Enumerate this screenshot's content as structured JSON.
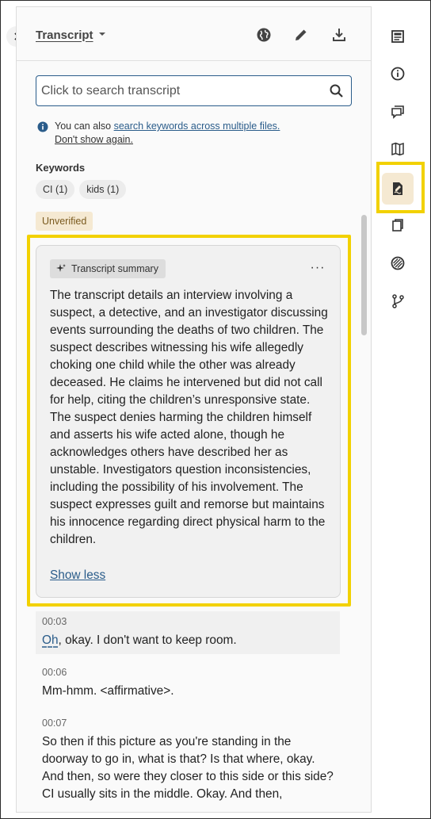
{
  "header": {
    "title": "Transcript",
    "icons": [
      "chevron-right-icon",
      "caret-down-icon",
      "globe-icon",
      "pencil-icon",
      "download-icon"
    ]
  },
  "search": {
    "placeholder": "Click to search transcript",
    "value": ""
  },
  "info": {
    "prefix": "You can also ",
    "link": "search keywords across multiple files.",
    "dismiss": "Don't show again."
  },
  "keywords": {
    "label": "Keywords",
    "items": [
      "CI (1)",
      "kids (1)"
    ]
  },
  "status_badge": "Unverified",
  "summary": {
    "tag": "Transcript summary",
    "more": "···",
    "text": "The transcript details an interview involving a suspect, a detective, and an investigator discussing events surrounding the deaths of two children. The suspect describes witnessing his wife allegedly choking one child while the other was already deceased. He claims he intervened but did not call for help, citing the children’s unresponsive state. The suspect denies harming the children himself and asserts his wife acted alone, though he acknowledges others have described her as unstable. Investigators question inconsistencies, including the possibility of his involvement. The suspect expresses guilt and remorse but maintains his innocence regarding direct physical harm to the children.",
    "show_less": "Show less"
  },
  "segments": [
    {
      "time": "00:03",
      "first_word": "Oh",
      "text": ", okay. I don't want to keep room."
    },
    {
      "time": "00:06",
      "text": "Mm-hmm. <affirmative>."
    },
    {
      "time": "00:07",
      "text": "So then if this picture as you're standing in the doorway to go in, what is that? Is that where, okay. And then, so were they closer to this side or this side? CI usually sits in the middle. Okay. And then,"
    }
  ],
  "rail": {
    "icons": [
      "document-icon",
      "info-icon",
      "comments-icon",
      "map-icon",
      "summary-edit-icon",
      "copy-icon",
      "redact-icon",
      "branch-icon"
    ],
    "active": "summary-edit-icon"
  },
  "colors": {
    "accent": "#2a5c8a",
    "highlight": "#f2d100",
    "badge_bg": "#f5e9d2",
    "badge_text": "#7a5a1f"
  }
}
